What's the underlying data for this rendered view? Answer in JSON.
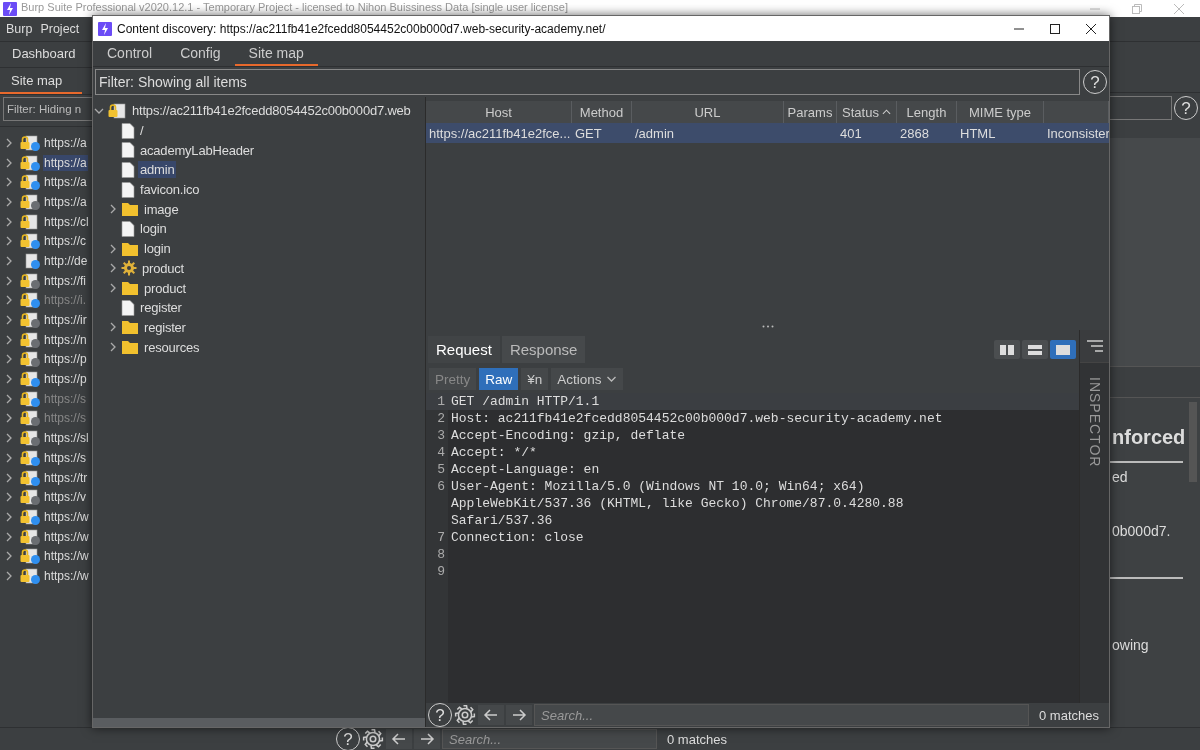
{
  "app_window": {
    "title": "Burp Suite Professional v2020.12.1 - Temporary Project - licensed to Nihon Buissiness Data [single user license]",
    "menu": [
      "Burp",
      "Project"
    ],
    "tabs": [
      {
        "label": "Dashboard",
        "selected": false
      }
    ],
    "subtabs": [
      {
        "label": "Site map",
        "selected": true
      }
    ],
    "filter": {
      "value": "Filter: Hiding n"
    },
    "help_button": "?",
    "hosts": [
      {
        "label": "https://a",
        "lock": true,
        "color": "#2f8ff0",
        "dimmed": false,
        "selected": false
      },
      {
        "label": "https://a",
        "lock": true,
        "color": "#2f8ff0",
        "dimmed": false,
        "selected": true
      },
      {
        "label": "https://a",
        "lock": true,
        "color": "#2f8ff0",
        "dimmed": false,
        "selected": false
      },
      {
        "label": "https://a",
        "lock": true,
        "color": "#6b6e72",
        "dimmed": false,
        "selected": false
      },
      {
        "label": "https://cl",
        "lock": true,
        "dimmed": false,
        "selected": false
      },
      {
        "label": "https://c",
        "lock": true,
        "color": "#2f8ff0",
        "dimmed": false,
        "selected": false
      },
      {
        "label": "http://de",
        "lock": false,
        "color": "#2f8ff0",
        "dimmed": false,
        "selected": false
      },
      {
        "label": "https://fi",
        "lock": true,
        "color": "#6b6e72",
        "dimmed": false,
        "selected": false
      },
      {
        "label": "https://i.",
        "lock": true,
        "color": "#2f8ff0",
        "dimmed": true,
        "selected": false
      },
      {
        "label": "https://ir",
        "lock": true,
        "color": "#6b6e72",
        "dimmed": false,
        "selected": false
      },
      {
        "label": "https://n",
        "lock": true,
        "color": "#6b6e72",
        "dimmed": false,
        "selected": false
      },
      {
        "label": "https://p",
        "lock": true,
        "color": "#6b6e72",
        "dimmed": false,
        "selected": false
      },
      {
        "label": "https://p",
        "lock": true,
        "color": "#2f8ff0",
        "dimmed": false,
        "selected": false
      },
      {
        "label": "https://s",
        "lock": true,
        "color": "#2f8ff0",
        "dimmed": true,
        "selected": false
      },
      {
        "label": "https://s",
        "lock": true,
        "color": "#6b6e72",
        "dimmed": true,
        "selected": false
      },
      {
        "label": "https://sl",
        "lock": true,
        "color": "#6b6e72",
        "dimmed": false,
        "selected": false
      },
      {
        "label": "https://s",
        "lock": true,
        "color": "#2f8ff0",
        "dimmed": false,
        "selected": false
      },
      {
        "label": "https://tr",
        "lock": true,
        "color": "#2f8ff0",
        "dimmed": false,
        "selected": false
      },
      {
        "label": "https://v",
        "lock": true,
        "color": "#6b6e72",
        "dimmed": false,
        "selected": false
      },
      {
        "label": "https://w",
        "lock": true,
        "color": "#2f8ff0",
        "dimmed": false,
        "selected": false
      },
      {
        "label": "https://w",
        "lock": true,
        "color": "#6b6e72",
        "dimmed": false,
        "selected": false
      },
      {
        "label": "https://w",
        "lock": true,
        "color": "#2f8ff0",
        "dimmed": false,
        "selected": false
      },
      {
        "label": "https://w",
        "lock": true,
        "color": "#2f8ff0",
        "dimmed": false,
        "selected": false
      }
    ],
    "details": {
      "heading": "nforced",
      "texts": [
        "ed",
        "0b000d7."
      ],
      "footer_text": "owing"
    },
    "search_bar": {
      "help_button": "?",
      "placeholder": "Search...",
      "matches": "0 matches"
    }
  },
  "dialog": {
    "title": "Content discovery: https://ac211fb41e2fcedd8054452c00b000d7.web-security-academy.net/",
    "tabs": [
      {
        "label": "Control",
        "selected": false
      },
      {
        "label": "Config",
        "selected": false
      },
      {
        "label": "Site map",
        "selected": true
      }
    ],
    "filter": {
      "value": "Filter: Showing all items"
    },
    "help_button": "?",
    "tree": {
      "label": "https://ac211fb41e2fcedd8054452c00b000d7.web",
      "kind": "host",
      "expanded": true,
      "selected": false,
      "children": [
        {
          "label": "/",
          "kind": "file",
          "selected": false
        },
        {
          "label": "academyLabHeader",
          "kind": "file",
          "selected": false
        },
        {
          "label": "admin",
          "kind": "file",
          "selected": true
        },
        {
          "label": "favicon.ico",
          "kind": "file",
          "selected": false
        },
        {
          "label": "image",
          "kind": "folder",
          "expanded": false,
          "selected": false
        },
        {
          "label": "login",
          "kind": "file",
          "selected": false
        },
        {
          "label": "login",
          "kind": "folder",
          "expanded": false,
          "selected": false
        },
        {
          "label": "product",
          "kind": "gear",
          "expanded": false,
          "selected": false
        },
        {
          "label": "product",
          "kind": "folder",
          "expanded": false,
          "selected": false
        },
        {
          "label": "register",
          "kind": "file",
          "selected": false
        },
        {
          "label": "register",
          "kind": "folder",
          "expanded": false,
          "selected": false
        },
        {
          "label": "resources",
          "kind": "folder",
          "expanded": false,
          "selected": false
        }
      ]
    },
    "table": {
      "columns": [
        {
          "label": "Host",
          "sorted": false
        },
        {
          "label": "Method",
          "sorted": false
        },
        {
          "label": "URL",
          "sorted": false
        },
        {
          "label": "Params",
          "sorted": false
        },
        {
          "label": "Status",
          "sorted": true
        },
        {
          "label": "Length",
          "sorted": false
        },
        {
          "label": "MIME type",
          "sorted": false
        },
        {
          "sorted": false
        }
      ],
      "rows": [
        {
          "cells": [
            "https://ac211fb41e2fce...",
            "GET",
            "/admin",
            null,
            "401",
            "2868",
            "HTML",
            "Inconsister"
          ],
          "selected": true
        }
      ]
    },
    "message_tabs": [
      {
        "label": "Request",
        "selected": true
      },
      {
        "label": "Response",
        "selected": false
      }
    ],
    "views": [
      {
        "kind": "columns",
        "selected": false
      },
      {
        "kind": "rows",
        "selected": false
      },
      {
        "kind": "single",
        "selected": true
      }
    ],
    "modes": [
      {
        "label": "Pretty",
        "selected": false
      },
      {
        "label": "Raw",
        "selected": true
      }
    ],
    "newline_button": "¥n",
    "actions_button": "Actions",
    "lines": [
      {
        "number": "1",
        "text": "GET /admin HTTP/1.1",
        "highlighted": true
      },
      {
        "number": "2",
        "text": "Host: ac211fb41e2fcedd8054452c00b000d7.web-security-academy.net",
        "highlighted": false
      },
      {
        "number": "3",
        "text": "Accept-Encoding: gzip, deflate",
        "highlighted": false
      },
      {
        "number": "4",
        "text": "Accept: */*",
        "highlighted": false
      },
      {
        "number": "5",
        "text": "Accept-Language: en",
        "highlighted": false
      },
      {
        "number": "6",
        "text": "User-Agent: Mozilla/5.0 (Windows NT 10.0; Win64; x64)",
        "continued": [
          "AppleWebKit/537.36 (KHTML, like Gecko) Chrome/87.0.4280.88",
          "Safari/537.36"
        ],
        "highlighted": false
      },
      {
        "number": "7",
        "text": "Connection: close",
        "highlighted": false
      },
      {
        "number": "8",
        "highlighted": false
      },
      {
        "number": "9",
        "highlighted": false
      }
    ],
    "inspector": "INSPECTOR",
    "search_bar": {
      "help_button": "?",
      "placeholder": "Search...",
      "matches": "0 matches"
    }
  }
}
